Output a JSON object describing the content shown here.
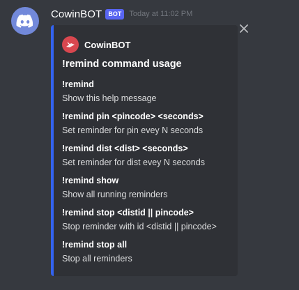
{
  "message": {
    "username": "CowinBOT",
    "bot_tag": "BOT",
    "timestamp": "Today at 11:02 PM"
  },
  "embed": {
    "author": "CowinBOT",
    "title": "!remind command usage",
    "accent_color": "#3363f0",
    "fields": [
      {
        "name": "!remind",
        "value": "Show this help message"
      },
      {
        "name": "!remind pin <pincode> <seconds>",
        "value": "Set reminder for pin evey N seconds"
      },
      {
        "name": "!remind dist <dist> <seconds>",
        "value": "Set reminder for dist evey N seconds"
      },
      {
        "name": "!remind show",
        "value": "Show all running reminders"
      },
      {
        "name": "!remind stop <distid || pincode>",
        "value": "Stop reminder with id <distid || pincode>"
      },
      {
        "name": "!remind stop all",
        "value": "Stop all reminders"
      }
    ]
  },
  "icons": {
    "avatar": "discord-logo-icon",
    "author": "author-avatar-icon",
    "close": "close-icon"
  }
}
